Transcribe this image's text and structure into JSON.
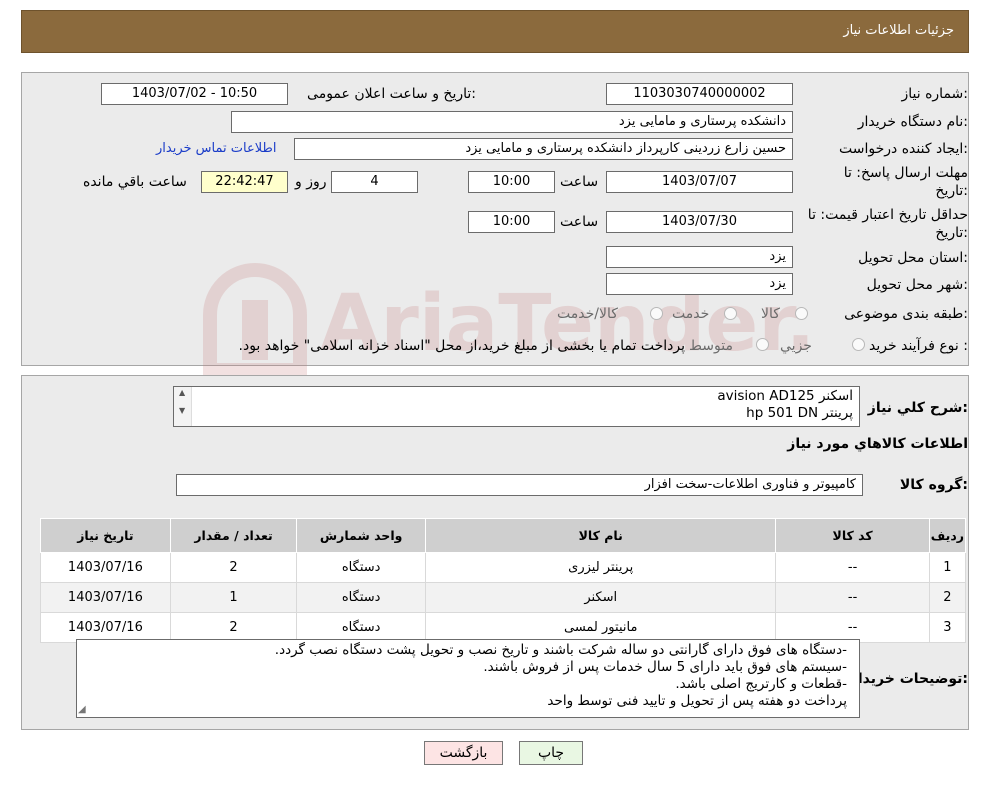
{
  "header": {
    "title": "جزئیات اطلاعات نیاز"
  },
  "form": {
    "need_number_label": "شماره نیاز:",
    "need_number": "1103030740000002",
    "announce_label": "تاریخ و ساعت اعلان عمومی:",
    "announce_value": "1403/07/02 - 10:50",
    "buyer_org_label": "نام دستگاه خریدار:",
    "buyer_org": "دانشکده پرستاری و مامایی  یزد",
    "creator_label": "ایجاد کننده درخواست:",
    "creator": "حسین زارع زردینی کارپرداز دانشکده پرستاری و مامایی  یزد",
    "contact_link": "اطلاعات تماس خریدار",
    "deadline_label_1": "مهلت ارسال پاسخ: تا",
    "deadline_label_2": "تاریخ:",
    "deadline_date": "1403/07/07",
    "time_label": "ساعت",
    "deadline_time": "10:00",
    "days_value": "4",
    "days_label": "روز و",
    "remaining_time": "22:42:47",
    "remaining_label": "ساعت باقي مانده",
    "validity_label_1": "حداقل تاریخ اعتبار قیمت: تا",
    "validity_label_2": "تاریخ:",
    "validity_date": "1403/07/30",
    "validity_time": "10:00",
    "province_label": "استان محل تحویل:",
    "province": "یزد",
    "city_label": "شهر محل تحویل:",
    "city": "یزد",
    "category_label": "طبقه بندی موضوعی:",
    "category_options": [
      "کالا",
      "خدمت",
      "کالا/خدمت"
    ],
    "process_label": "نوع فرآیند خرید :",
    "process_options": [
      "جزیي",
      "متوسط"
    ],
    "process_note": "پرداخت تمام یا بخشی از مبلغ خرید،از محل \"اسناد خزانه اسلامی\" خواهد بود."
  },
  "description": {
    "label": "شرح کلي نياز:",
    "lines": [
      "اسکنر avision AD125",
      "پرینتر hp 501 DN"
    ]
  },
  "goods_section_title": "اطلاعات کالاهاي مورد نياز",
  "goods_group": {
    "label": "گروه کالا:",
    "value": "کامپیوتر و فناوری اطلاعات-سخت افزار"
  },
  "table": {
    "headers": [
      "رديف",
      "کد کالا",
      "نام کالا",
      "واحد شمارش",
      "تعداد / مقدار",
      "تاریخ نیاز"
    ],
    "rows": [
      [
        "1",
        "--",
        "پرینتر لیزری",
        "دستگاه",
        "2",
        "1403/07/16"
      ],
      [
        "2",
        "--",
        "اسکنر",
        "دستگاه",
        "1",
        "1403/07/16"
      ],
      [
        "3",
        "--",
        "مانیتور لمسی",
        "دستگاه",
        "2",
        "1403/07/16"
      ]
    ]
  },
  "buyer_notes": {
    "label": "توضیحات خریدار:",
    "lines": [
      "-دستگاه های فوق دارای گارانتی دو ساله شرکت باشند و تاریخ نصب و تحویل پشت دستگاه نصب گردد.",
      "-سیستم های فوق باید دارای 5 سال خدمات پس از فروش باشند.",
      "-قطعات و کارتریج اصلی باشد.",
      "پرداخت دو هفته پس از تحویل و تایید فنی توسط واحد"
    ]
  },
  "buttons": {
    "print": "چاپ",
    "back": "بازگشت"
  },
  "watermark_text": "AriaTender.neT",
  "colors": {
    "header_bg": "#8b6a3d",
    "panel_bg": "#ebebeb",
    "link": "#1a3cc8",
    "print_btn": "#e9f7e3",
    "back_btn": "#fde4e4"
  }
}
